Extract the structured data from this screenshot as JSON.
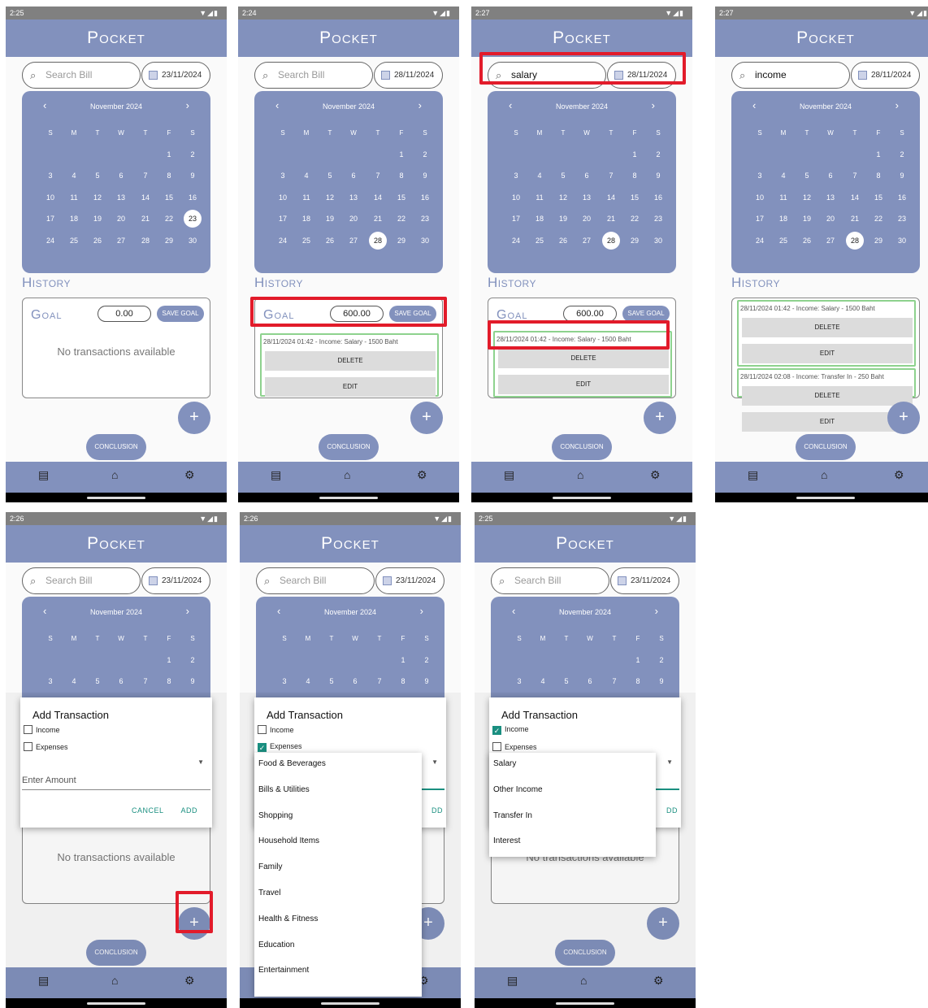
{
  "app": {
    "title": "Pocket",
    "history_label": "History",
    "goal_label": "Goal",
    "save_goal": "SAVE GOAL",
    "conclusion": "CONCLUSION",
    "no_tx": "No transactions available",
    "fab": "+"
  },
  "calendar": {
    "month": "November 2024",
    "prev": "‹",
    "next": "›",
    "weekdays": [
      "S",
      "M",
      "T",
      "W",
      "T",
      "F",
      "S"
    ]
  },
  "nav_icons": [
    "list-icon",
    "home-icon",
    "gear-icon"
  ],
  "screens": [
    {
      "time": "2:25",
      "search": "",
      "placeholder": "Search Bill",
      "date": "23/11/2024",
      "goal": "0.00",
      "selected": 23
    },
    {
      "time": "2:24",
      "search": "",
      "placeholder": "Search Bill",
      "date": "28/11/2024",
      "goal": "600.00",
      "selected": 28
    },
    {
      "time": "2:27",
      "search": "salary",
      "placeholder": "Search Bill",
      "date": "28/11/2024",
      "goal": "600.00",
      "selected": 28
    },
    {
      "time": "2:27",
      "search": "income",
      "placeholder": "Search Bill",
      "date": "28/11/2024",
      "goal": "",
      "selected": 28
    },
    {
      "time": "2:26",
      "search": "",
      "placeholder": "Search Bill",
      "date": "23/11/2024",
      "goal": "",
      "selected": 0
    },
    {
      "time": "2:26",
      "search": "",
      "placeholder": "Search Bill",
      "date": "23/11/2024",
      "goal": "",
      "selected": 0
    },
    {
      "time": "2:25",
      "search": "",
      "placeholder": "Search Bill",
      "date": "23/11/2024",
      "goal": "",
      "selected": 0
    }
  ],
  "transactions": {
    "salary": "28/11/2024 01:42 - Income: Salary - 1500 Baht",
    "transfer": "28/11/2024 02:08 - Income: Transfer In - 250 Baht",
    "delete": "DELETE",
    "edit": "EDIT"
  },
  "dialog": {
    "title": "Add Transaction",
    "income": "Income",
    "expenses": "Expenses",
    "amount": "Enter Amount",
    "cancel": "CANCEL",
    "add": "ADD",
    "add_cut": "DD"
  },
  "expense_categories": [
    "Food & Beverages",
    "Bills & Utilities",
    "Shopping",
    "Household Items",
    "Family",
    "Travel",
    "Health & Fitness",
    "Education",
    "Entertainment"
  ],
  "income_categories": [
    "Salary",
    "Other Income",
    "Transfer In",
    "Interest"
  ],
  "colors": {
    "primary": "#8291bd",
    "accent": "#1a8f80",
    "highlight": "#e21b2a"
  }
}
